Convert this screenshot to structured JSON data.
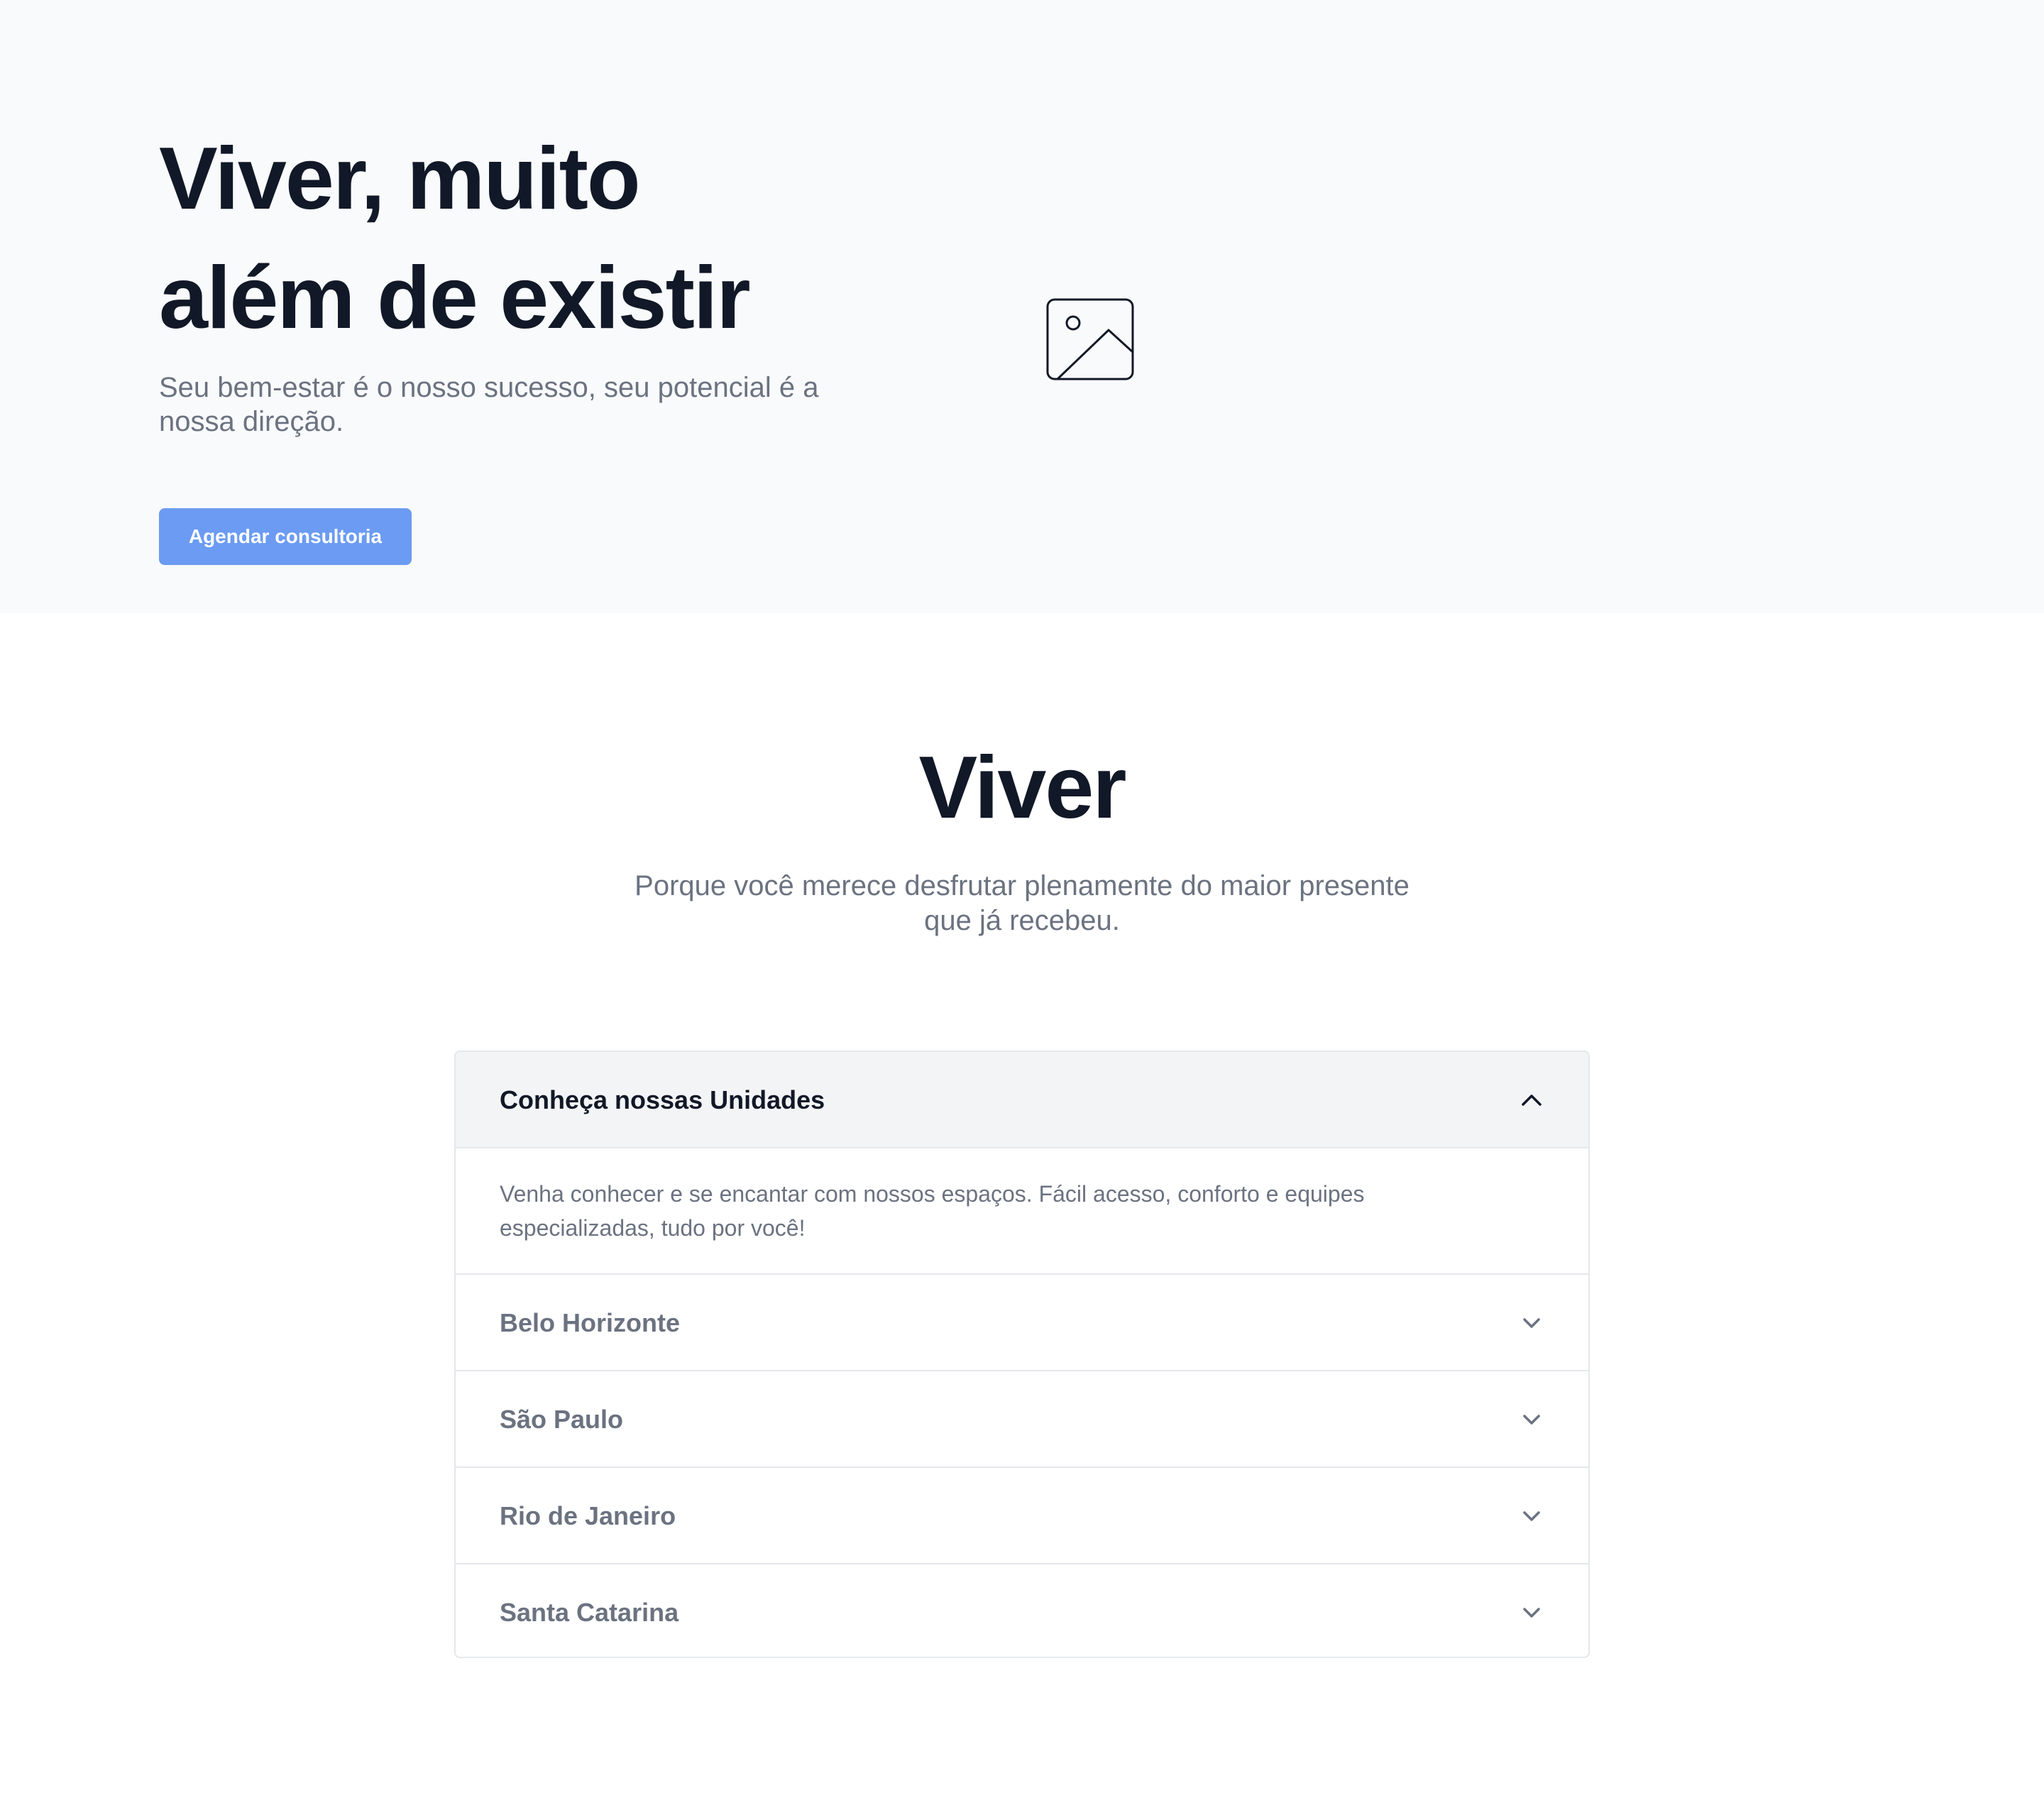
{
  "hero": {
    "title_line1": "Viver, muito",
    "title_line2": "além de existir",
    "subtitle": "Seu bem-estar é o nosso sucesso, seu potencial é a nossa direção.",
    "cta_label": "Agendar consultoria",
    "image_icon": "image-placeholder-icon"
  },
  "section": {
    "title": "Viver",
    "subtitle": "Porque você merece desfrutar plenamente do maior presente que já recebeu."
  },
  "accordion": {
    "header_label": "Conheça nossas Unidades",
    "header_icon": "chevron-up-icon",
    "body_text": "Venha conhecer e se encantar com nossos espaços. Fácil acesso, conforto e equipes especializadas, tudo por você!",
    "items": [
      {
        "label": "Belo Horizonte",
        "icon": "chevron-down-icon"
      },
      {
        "label": "São Paulo",
        "icon": "chevron-down-icon"
      },
      {
        "label": "Rio de Janeiro",
        "icon": "chevron-down-icon"
      },
      {
        "label": "Santa Catarina",
        "icon": "chevron-down-icon"
      }
    ]
  },
  "colors": {
    "hero_background": "#f9fafb",
    "heading": "#111827",
    "muted_text": "#6b7280",
    "button": "#6b9bf2",
    "accordion_header_bg": "#f3f4f6",
    "border": "#e5e7eb"
  }
}
